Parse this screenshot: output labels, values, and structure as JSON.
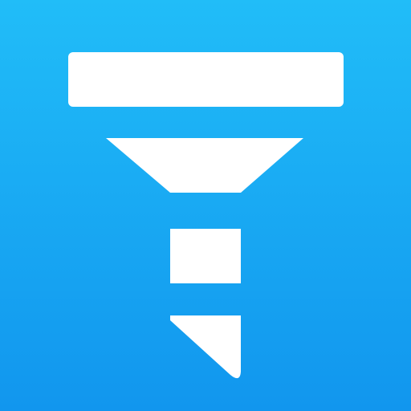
{
  "app_icon": {
    "icon_name": "funnel-filter-icon",
    "background_gradient": {
      "top_color": "#21BDF8",
      "bottom_color": "#1196EE"
    },
    "glyph_color": "#FFFFFF"
  }
}
